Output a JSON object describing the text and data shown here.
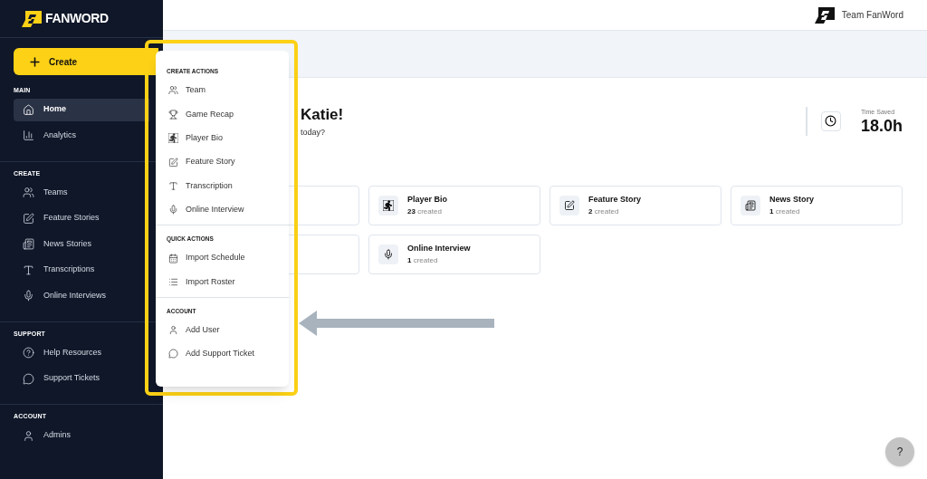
{
  "brand": {
    "name": "FANWORD"
  },
  "sidebar": {
    "create_button": "Create",
    "sections": [
      {
        "title": "MAIN",
        "items": [
          {
            "label": "Home",
            "selected": true
          },
          {
            "label": "Analytics",
            "selected": false
          }
        ]
      },
      {
        "title": "CREATE",
        "items": [
          {
            "label": "Teams",
            "selected": false
          },
          {
            "label": "Feature Stories",
            "selected": false
          },
          {
            "label": "News Stories",
            "selected": false
          },
          {
            "label": "Transcriptions",
            "selected": false
          },
          {
            "label": "Online Interviews",
            "selected": false
          }
        ]
      },
      {
        "title": "SUPPORT",
        "items": [
          {
            "label": "Help Resources",
            "selected": false
          },
          {
            "label": "Support Tickets",
            "selected": false
          }
        ]
      },
      {
        "title": "ACCOUNT",
        "items": [
          {
            "label": "Admins",
            "selected": false
          }
        ]
      }
    ]
  },
  "header": {
    "team": "Team FanWord"
  },
  "greeting": {
    "title": "Katie!",
    "subtitle": "today?"
  },
  "time_saved": {
    "label": "Time Saved",
    "value": "18.0h"
  },
  "cards": [
    {
      "title": "Player Bio",
      "count": "23",
      "suffix": "created"
    },
    {
      "title": "Feature Story",
      "count": "2",
      "suffix": "created"
    },
    {
      "title": "News Story",
      "count": "1",
      "suffix": "created"
    },
    {
      "title": "Online Interview",
      "count": "1",
      "suffix": "created"
    }
  ],
  "create_menu": {
    "sections": [
      {
        "title": "CREATE ACTIONS",
        "items": [
          "Team",
          "Game Recap",
          "Player Bio",
          "Feature Story",
          "Transcription",
          "Online Interview"
        ]
      },
      {
        "title": "QUICK ACTIONS",
        "items": [
          "Import Schedule",
          "Import Roster"
        ]
      },
      {
        "title": "ACCOUNT",
        "items": [
          "Add User",
          "Add Support Ticket"
        ]
      }
    ]
  },
  "help_button": "?"
}
